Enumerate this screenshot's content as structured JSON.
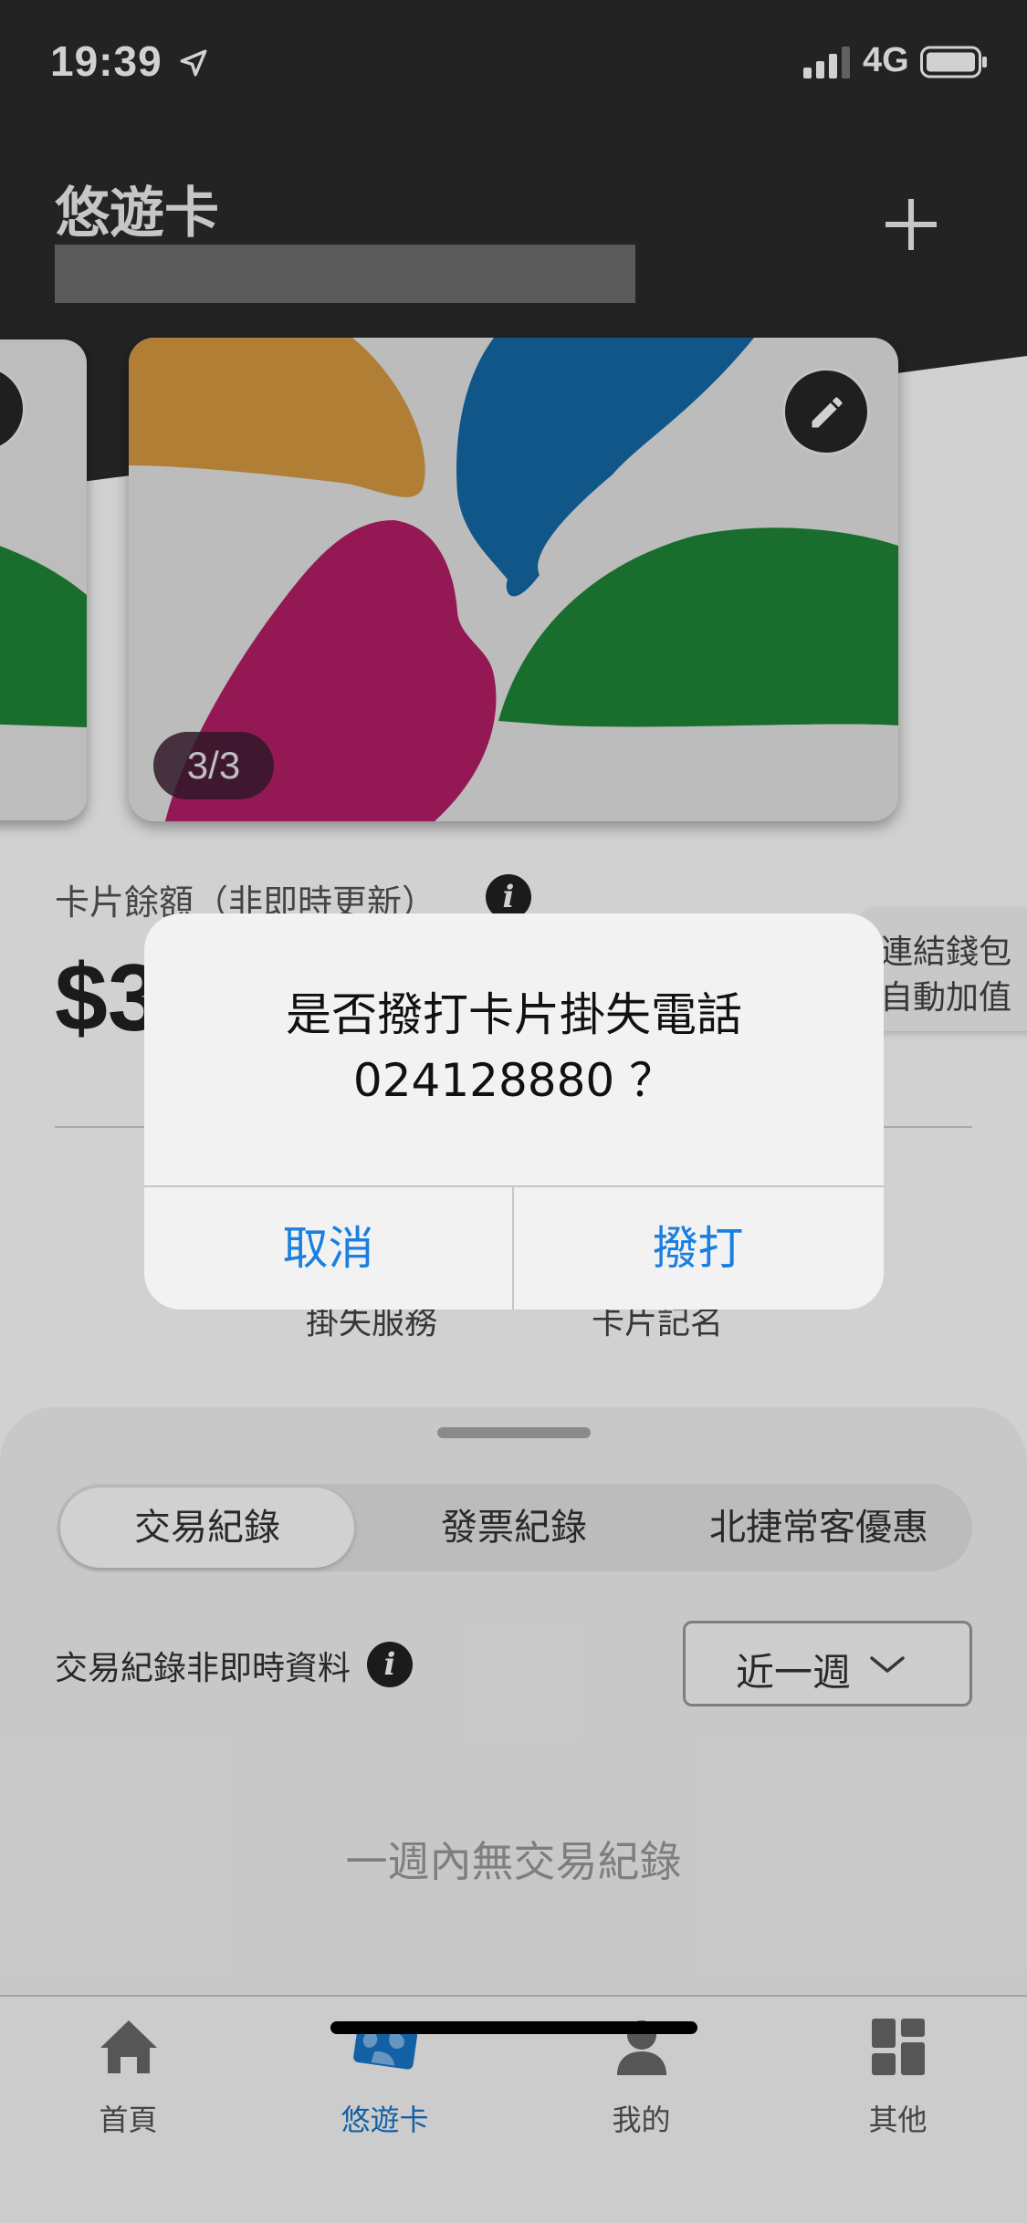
{
  "status_bar": {
    "time": "19:39",
    "network": "4G"
  },
  "header": {
    "title": "悠遊卡"
  },
  "card": {
    "counter": "3/3"
  },
  "balance": {
    "label": "卡片餘額（非即時更新）",
    "amount": "$3"
  },
  "side_menu": {
    "line1": "連結錢包",
    "line2": "自動加值"
  },
  "services": {
    "lost_report": "掛失服務",
    "card_register": "卡片記名"
  },
  "sheet": {
    "tabs": [
      "交易紀錄",
      "發票紀錄",
      "北捷常客優惠"
    ],
    "active_tab": "交易紀錄",
    "notice": "交易紀錄非即時資料",
    "period": "近一週",
    "empty_message": "一週內無交易紀錄"
  },
  "tabbar": {
    "items": [
      {
        "label": "首頁",
        "icon": "home-icon"
      },
      {
        "label": "悠遊卡",
        "icon": "easycard-icon"
      },
      {
        "label": "我的",
        "icon": "person-icon"
      },
      {
        "label": "其他",
        "icon": "grid-icon"
      }
    ],
    "active": "悠遊卡"
  },
  "alert": {
    "message_line1": "是否撥打卡片掛失電話",
    "message_line2": "024128880 ？",
    "cancel": "取消",
    "confirm": "撥打"
  },
  "colors": {
    "header_bg": "#2b2b2b",
    "accent_blue": "#1a7fe0",
    "tab_active": "#1976c8",
    "card_orange": "#d89a43",
    "card_blue": "#1469a8",
    "card_magenta": "#b51e66",
    "card_green": "#1f8737"
  }
}
